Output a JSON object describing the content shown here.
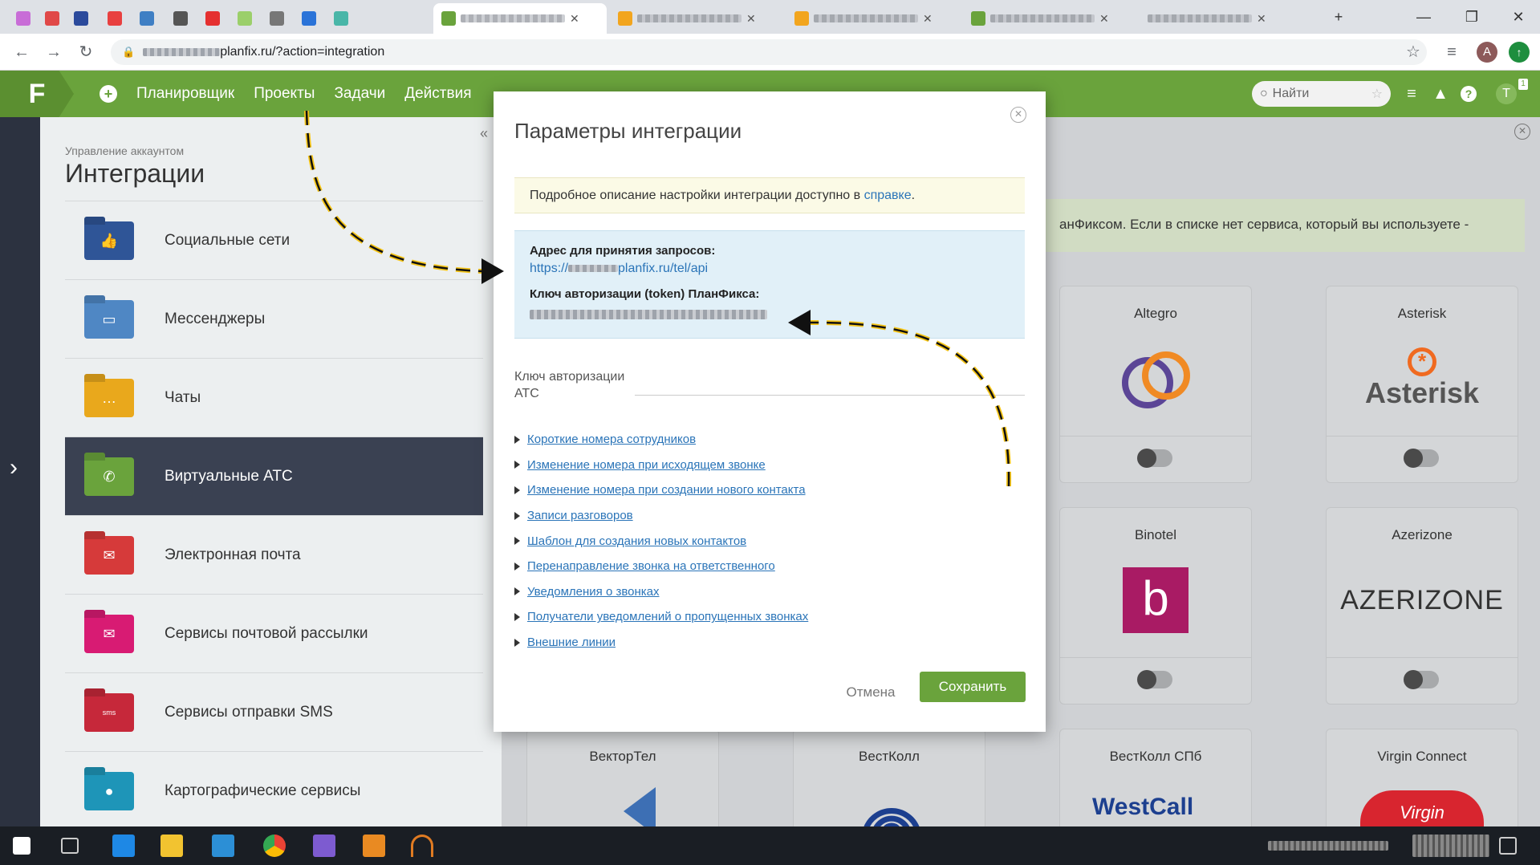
{
  "browser": {
    "tabs": [
      "",
      "",
      "",
      "",
      "",
      "",
      "",
      "",
      "",
      "",
      "",
      "",
      ""
    ],
    "new_tab": "+",
    "window": {
      "minimize": "—",
      "restore": "❐",
      "close": "✕"
    },
    "url_suffix": "planfix.ru/?action=integration",
    "nav": {
      "back": "←",
      "forward": "→",
      "reload": "↻"
    },
    "avatar": "A"
  },
  "header": {
    "logo": "F",
    "menu": [
      "Планировщик",
      "Проекты",
      "Задачи",
      "Действия"
    ],
    "search_label": "Найти",
    "user_initial": "T",
    "user_badge": "1"
  },
  "panel": {
    "breadcrumb": "Управление аккаунтом",
    "title": "Интеграции",
    "items": [
      {
        "label": "Социальные сети",
        "color": "#2f5597"
      },
      {
        "label": "Мессенджеры",
        "color": "#4f87c4"
      },
      {
        "label": "Чаты",
        "color": "#e9a81c"
      },
      {
        "label": "Виртуальные АТС",
        "color": "#6aa33c"
      },
      {
        "label": "Электронная почта",
        "color": "#d63a3a"
      },
      {
        "label": "Сервисы почтовой рассылки",
        "color": "#d81b73"
      },
      {
        "label": "Сервисы отправки SMS",
        "color": "#c6283a"
      },
      {
        "label": "Картографические сервисы",
        "color": "#1e95b8"
      }
    ]
  },
  "right": {
    "info_text": "анФиксом. Если в списке нет сервиса, который вы используете -",
    "cards": [
      {
        "name": "Altegro"
      },
      {
        "name": "Asterisk"
      },
      {
        "name": "Binotel"
      },
      {
        "name": "Azerizone"
      },
      {
        "name": "ВекторТел"
      },
      {
        "name": "ВестКолл"
      },
      {
        "name": "ВестКолл СПб"
      },
      {
        "name": "Virgin Connect"
      }
    ],
    "logos": {
      "asterisk": "Asterisk",
      "binotel": "b",
      "azerizone": "AZERIZONE",
      "westcall": "WestCall",
      "virgin": "Virgin"
    }
  },
  "modal": {
    "title": "Параметры интеграции",
    "notice_text": "Подробное описание настройки интеграции доступно в ",
    "notice_link": "справке",
    "notice_end": ".",
    "addr_label": "Адрес для принятия запросов:",
    "addr_url_prefix": "https://",
    "addr_url_suffix": "planfix.ru/tel/api",
    "token_label": "Ключ авторизации (token) ПланФикса:",
    "key_label": "Ключ авторизации АТС",
    "key_value": "",
    "links": [
      "Короткие номера сотрудников",
      "Изменение номера при исходящем звонке",
      "Изменение номера при создании нового контакта",
      "Записи разговоров",
      "Шаблон для создания новых контактов",
      "Перенаправление звонка на ответственного",
      "Уведомления о звонках",
      "Получатели уведомлений о пропущенных звонках",
      "Внешние линии"
    ],
    "cancel": "Отмена",
    "save": "Сохранить"
  },
  "colors": {
    "brand": "#6aa33c",
    "link": "#2a74b8",
    "dark": "#3a4152"
  }
}
